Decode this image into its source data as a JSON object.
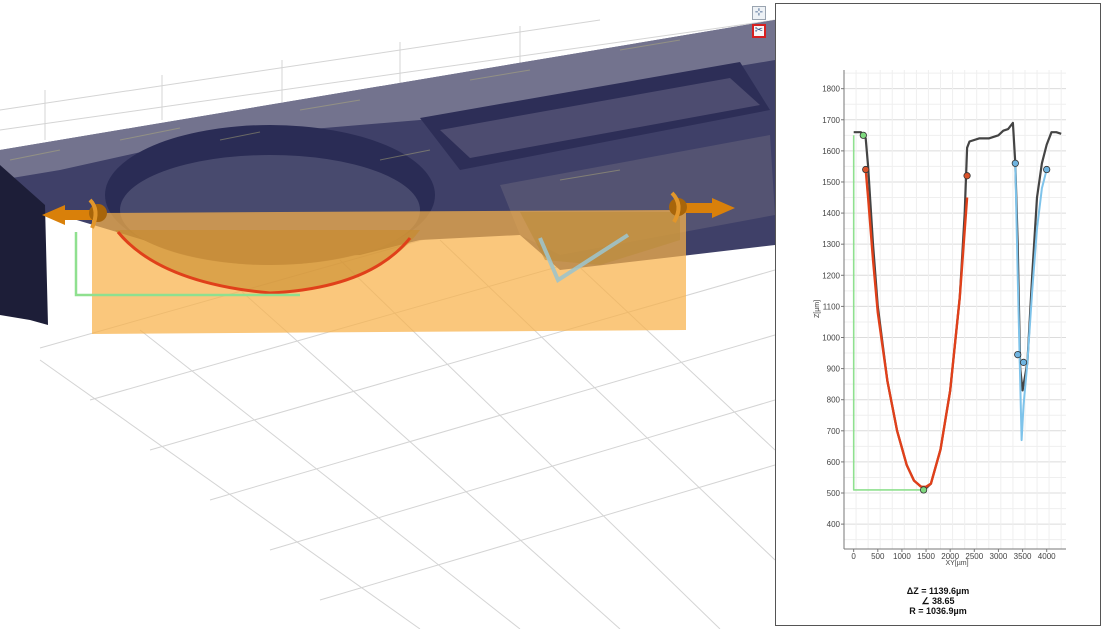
{
  "toolbar": {
    "view_button_icon": "axes-view-icon",
    "tool_button_icon": "scissors-icon",
    "view_glyph": "⊹",
    "tool_glyph": "✂"
  },
  "colors": {
    "surface_dark": "#3a3b63",
    "surface_light": "#8a8a9c",
    "cut_plane": "#f8b24a",
    "profile_gray": "#444444",
    "fit_red": "#e0401a",
    "fit_blue": "#7ec3ea",
    "marker_green": "#8fe08f",
    "arrow_orange": "#d9800a"
  },
  "profile": {
    "y_axis_label": "Z[µm]",
    "x_axis_label": "XY[µm]",
    "y_ticks": [
      "1800",
      "1700",
      "1600",
      "1500",
      "1400",
      "1300",
      "1200",
      "1100",
      "1000",
      "900",
      "800",
      "700",
      "600",
      "500",
      "400"
    ],
    "x_ticks": [
      "0",
      "500",
      "1000",
      "1500",
      "2000",
      "2500",
      "3000",
      "3500",
      "4000"
    ]
  },
  "chart_data": {
    "type": "line",
    "xlabel": "XY[µm]",
    "ylabel": "Z[µm]",
    "xlim": [
      -200,
      4400
    ],
    "ylim": [
      320,
      1860
    ],
    "grid": true,
    "series": [
      {
        "x": [
          0,
          150,
          250,
          300,
          400,
          500,
          700,
          900,
          1100,
          1250,
          1400,
          1500,
          1600,
          1800,
          2000,
          2200,
          2300,
          2350,
          2400,
          2600,
          2800,
          3000,
          3100,
          3200,
          3300,
          3350,
          3400,
          3450,
          3500,
          3600,
          3700,
          3800,
          3900,
          4000,
          4100,
          4200,
          4300
        ],
        "y": [
          1660,
          1660,
          1640,
          1550,
          1300,
          1100,
          860,
          700,
          590,
          540,
          520,
          515,
          530,
          640,
          830,
          1130,
          1400,
          1610,
          1630,
          1640,
          1640,
          1650,
          1665,
          1670,
          1690,
          1560,
          1300,
          900,
          830,
          920,
          1200,
          1450,
          1560,
          1620,
          1660,
          1660,
          1655
        ]
      },
      {
        "x": [
          250,
          300,
          400,
          500,
          700,
          900,
          1100,
          1250,
          1400,
          1500,
          1600,
          1800,
          2000,
          2200,
          2350
        ],
        "y": [
          1540,
          1450,
          1250,
          1080,
          860,
          700,
          590,
          540,
          520,
          520,
          530,
          640,
          830,
          1130,
          1450
        ]
      },
      {
        "x": [
          3350,
          3400,
          3450,
          3480,
          3520,
          3600,
          3700,
          3800,
          3900,
          4000
        ],
        "y": [
          1560,
          1200,
          860,
          670,
          780,
          920,
          1150,
          1350,
          1480,
          1540
        ]
      },
      {
        "x": [
          0,
          0,
          1450
        ],
        "y": [
          1650,
          510,
          510
        ]
      }
    ],
    "markers": [
      {
        "x": 200,
        "y": 1650,
        "color": "green"
      },
      {
        "x": 250,
        "y": 1540,
        "color": "red"
      },
      {
        "x": 2350,
        "y": 1520,
        "color": "red"
      },
      {
        "x": 1450,
        "y": 510,
        "color": "green"
      },
      {
        "x": 3350,
        "y": 1560,
        "color": "blue"
      },
      {
        "x": 3400,
        "y": 945,
        "color": "blue"
      },
      {
        "x": 3520,
        "y": 920,
        "color": "blue"
      },
      {
        "x": 4000,
        "y": 1540,
        "color": "blue"
      }
    ]
  },
  "results": {
    "delta_z": "ΔZ = 1139.6µm",
    "angle": "∠ 38.65",
    "radius": "R = 1036.9µm"
  }
}
